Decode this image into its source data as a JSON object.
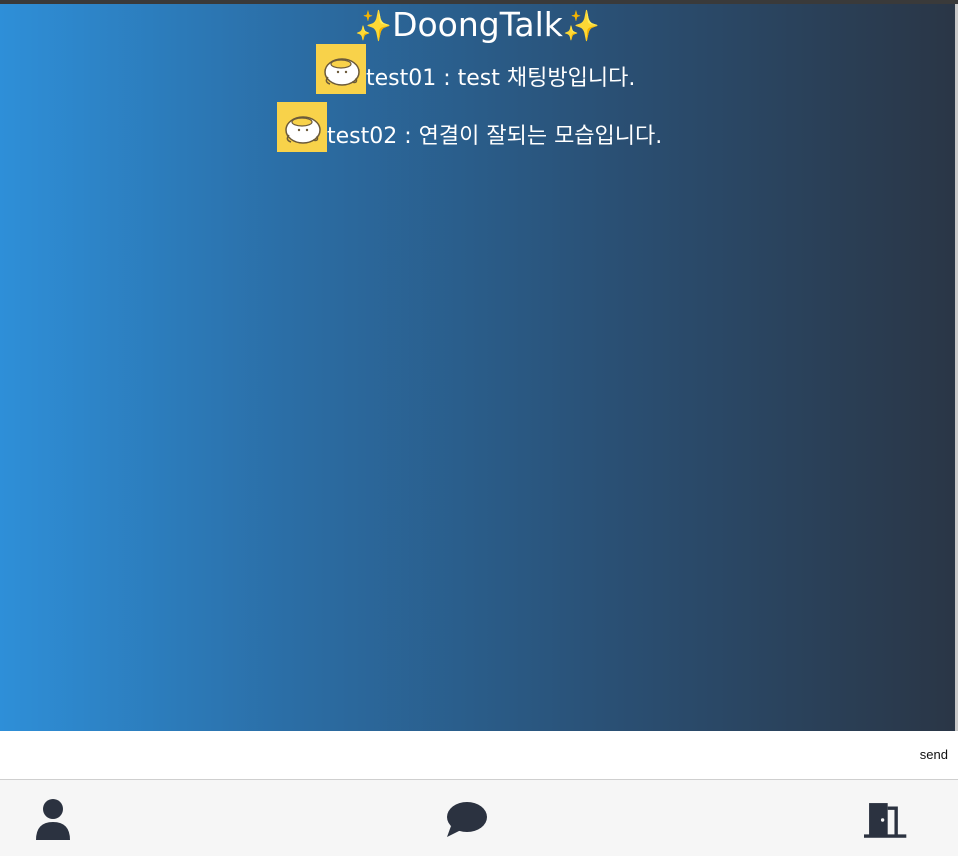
{
  "header": {
    "title": "DoongTalk",
    "sparkle_left": "✨",
    "sparkle_right": "✨"
  },
  "messages": [
    {
      "user": "test01",
      "text": "test01 : test 채팅방입니다."
    },
    {
      "user": "test02",
      "text": "test02 : 연결이 잘되는 모습입니다."
    }
  ],
  "composer": {
    "input_value": "",
    "input_placeholder": "",
    "send_label": "send"
  },
  "nav": {
    "profile_icon": "user-icon",
    "chat_icon": "chat-bubble-icon",
    "exit_icon": "door-exit-icon"
  },
  "colors": {
    "gradient_start": "#2e8fd8",
    "gradient_end": "#2a3646",
    "avatar_bg": "#f8d24a",
    "icon_color": "#2b3240"
  }
}
